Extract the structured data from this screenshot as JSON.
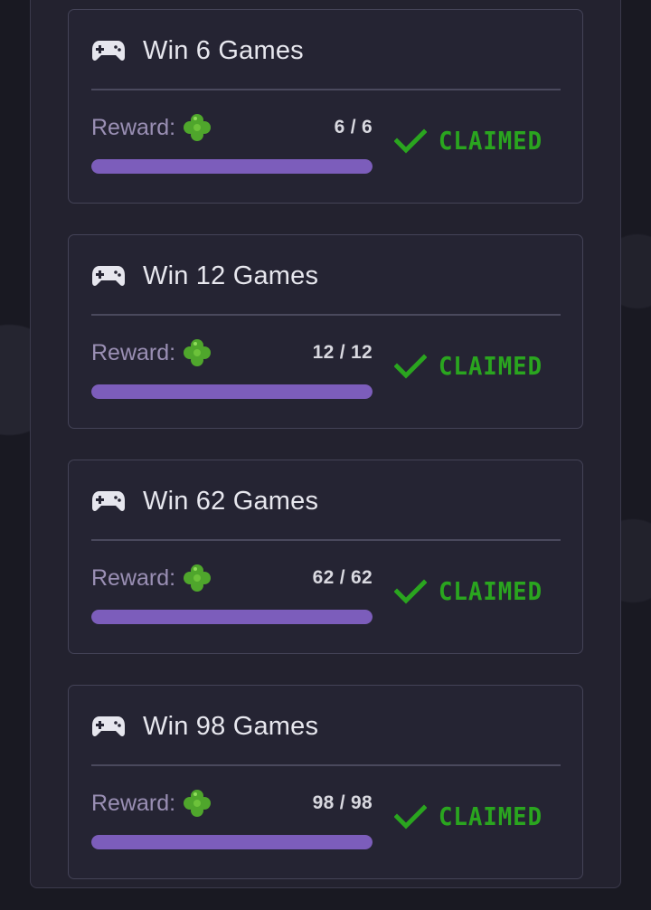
{
  "colors": {
    "background": "#191922",
    "panel": "#23222f",
    "card": "#252433",
    "progress_fill": "#7c5dbb",
    "claimed_green": "#2aa51f",
    "reward_label": "#9a8fb4"
  },
  "achievements": [
    {
      "title": "Win 6 Games",
      "reward_label": "Reward:",
      "reward_icon": "clover-icon",
      "progress_text": "6 / 6",
      "progress": 1.0,
      "status": "CLAIMED"
    },
    {
      "title": "Win 12 Games",
      "reward_label": "Reward:",
      "reward_icon": "clover-icon",
      "progress_text": "12 / 12",
      "progress": 1.0,
      "status": "CLAIMED"
    },
    {
      "title": "Win 62 Games",
      "reward_label": "Reward:",
      "reward_icon": "clover-icon",
      "progress_text": "62 / 62",
      "progress": 1.0,
      "status": "CLAIMED"
    },
    {
      "title": "Win 98 Games",
      "reward_label": "Reward:",
      "reward_icon": "clover-icon",
      "progress_text": "98 / 98",
      "progress": 1.0,
      "status": "CLAIMED"
    }
  ]
}
